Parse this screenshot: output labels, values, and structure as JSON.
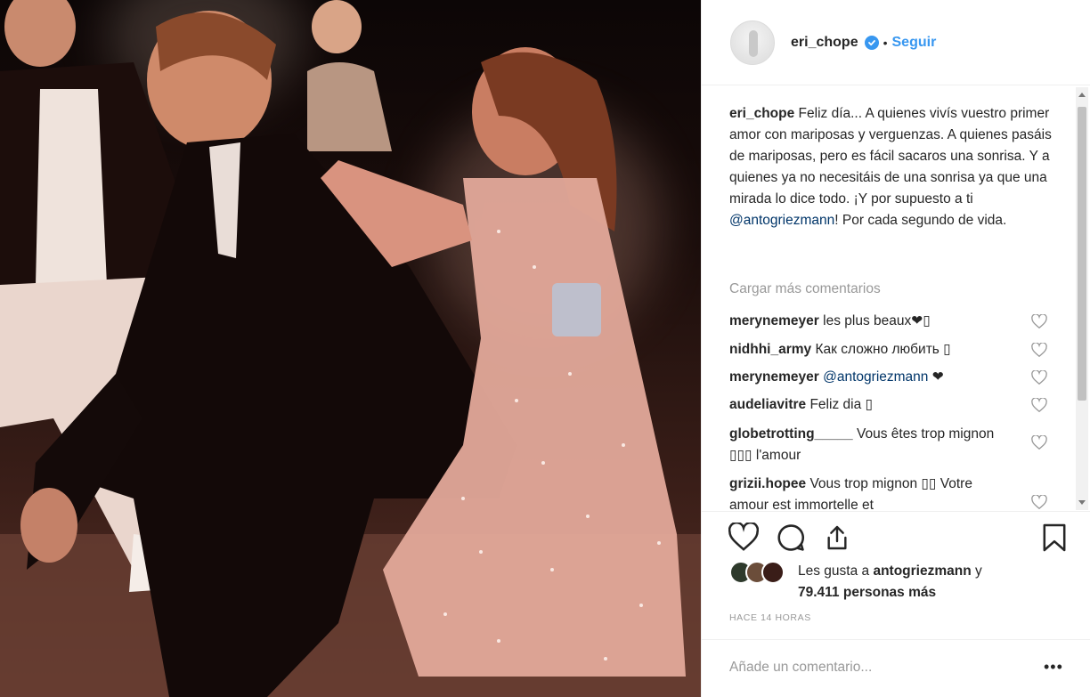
{
  "post": {
    "username": "eri_chope",
    "separator": "•",
    "follow_label": "Seguir"
  },
  "caption": {
    "username": "eri_chope",
    "text_1": "Feliz día... A quienes vivís vuestro primer amor con mariposas y verguenzas. A quienes pasáis de mariposas, pero es fácil sacaros una sonrisa. Y a quienes ya no necesitáis de una sonrisa ya que una mirada lo dice todo. ¡Y por supuesto a ti ",
    "mention": "@antogriezmann",
    "text_2": "! Por cada segundo de vida."
  },
  "load_more_label": "Cargar más comentarios",
  "comments": [
    {
      "user": "merynemeyer",
      "text": "les plus beaux❤▯"
    },
    {
      "user": "nidhhi_army",
      "text": "Как сложно любить ▯"
    },
    {
      "user": "merynemeyer",
      "mention": "@antogriezmann",
      "text": " ❤"
    },
    {
      "user": "audeliavitre",
      "text": "Feliz dia ▯"
    },
    {
      "user": "globetrotting_____",
      "text": "Vous êtes trop mignon ▯▯▯ l'amour"
    },
    {
      "user": "grizii.hopee",
      "text": "Vous trop mignon ▯▯ Votre amour est immortelle et"
    }
  ],
  "likes": {
    "prefix": "Les gusta a ",
    "user": "antogriezmann",
    "middle": " y ",
    "count": "79.411",
    "suffix": " personas más"
  },
  "timestamp": "HACE 14 HORAS",
  "add_comment_placeholder": "Añade un comentario...",
  "more_options": "•••",
  "icons": {
    "like": "heart-icon",
    "comment": "comment-icon",
    "share": "share-icon",
    "save": "bookmark-icon",
    "verified": "verified-badge-icon"
  },
  "colors": {
    "accent": "#3897f0",
    "mention": "#003569",
    "muted": "#999999"
  }
}
